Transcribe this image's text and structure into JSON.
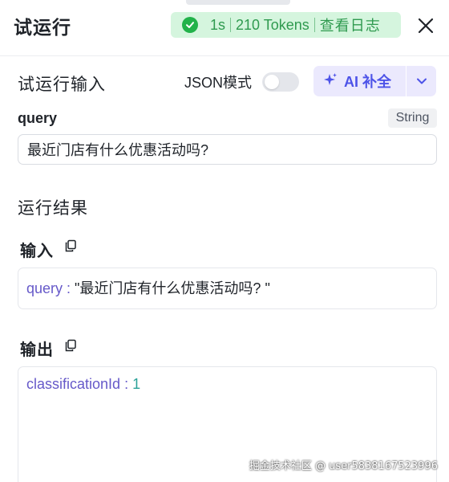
{
  "header": {
    "title": "试运行",
    "time": "1s",
    "tokens": "210 Tokens",
    "view_log": "查看日志"
  },
  "input_section": {
    "title": "试运行输入",
    "json_mode_label": "JSON模式",
    "json_mode_on": false,
    "ai_fill_label": "AI 补全",
    "field_name": "query",
    "field_type": "String",
    "field_value": "最近门店有什么优惠活动吗?"
  },
  "result_section": {
    "title": "运行结果",
    "input_label": "输入",
    "input_key": "query",
    "input_colon": " : ",
    "input_value": "\"最近门店有什么优惠活动吗? \"",
    "output_label": "输出",
    "output_key": "classificationId",
    "output_colon": " : ",
    "output_value": "1"
  },
  "watermark": "掘金技术社区 @ user5838167523996",
  "colors": {
    "success_bg": "#d5f5de",
    "success_text": "#2f9a4f",
    "accent": "#4d53e8",
    "accent_bg": "#ebe9fd",
    "json_key": "#6659c9",
    "json_number": "#2aa198"
  },
  "icons": [
    "check-circle-icon",
    "close-icon",
    "sparkle-icon",
    "chevron-down-icon",
    "copy-icon"
  ]
}
